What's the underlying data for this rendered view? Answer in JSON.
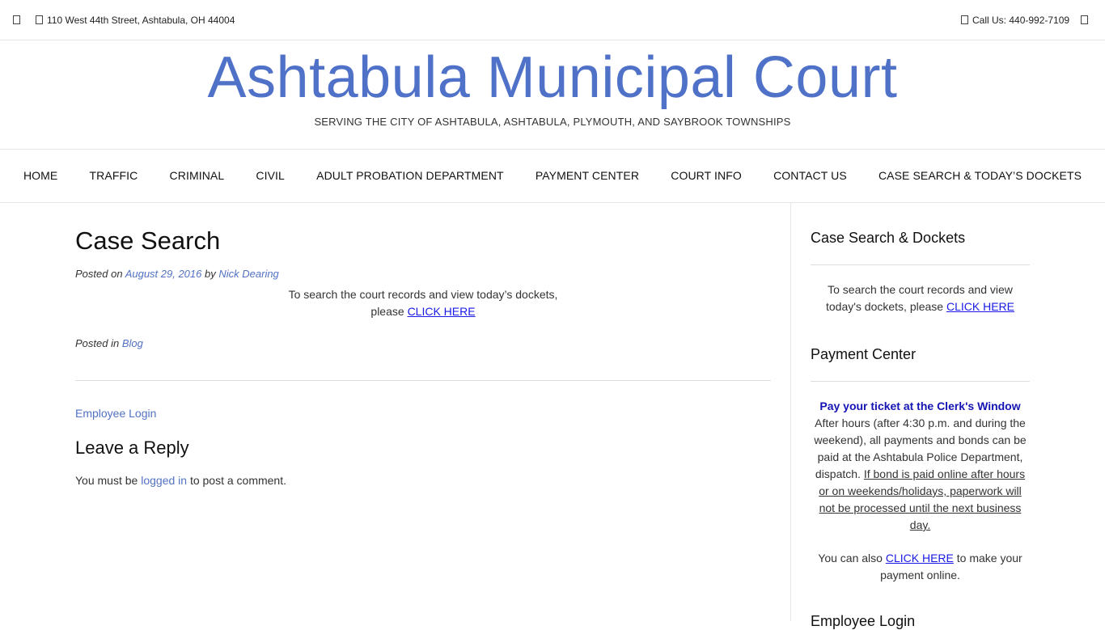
{
  "topbar": {
    "address": "110 West 44th Street, Ashtabula, OH 44004",
    "phone": "Call Us: 440-992-7109"
  },
  "header": {
    "title": "Ashtabula Municipal Court",
    "tagline": "SERVING THE CITY OF ASHTABULA, ASHTABULA, PLYMOUTH, AND SAYBROOK TOWNSHIPS"
  },
  "nav": {
    "items": [
      {
        "label": "HOME"
      },
      {
        "label": "TRAFFIC"
      },
      {
        "label": "CRIMINAL"
      },
      {
        "label": "CIVIL"
      },
      {
        "label": "ADULT PROBATION DEPARTMENT"
      },
      {
        "label": "PAYMENT CENTER"
      },
      {
        "label": "COURT INFO"
      },
      {
        "label": "CONTACT US"
      },
      {
        "label": "CASE SEARCH & TODAY’S DOCKETS"
      }
    ]
  },
  "post": {
    "title": "Case Search",
    "posted_on": "Posted on",
    "date": "August 29, 2016",
    "by": "by",
    "author": "Nick Dearing",
    "body_line1": "To search the court records and view today’s dockets,",
    "body_please": "please",
    "body_link": "CLICK HERE",
    "posted_in": "Posted in",
    "category": "Blog"
  },
  "employee_login": "Employee Login",
  "reply": {
    "title": "Leave a Reply",
    "text_before": "You must be",
    "link": "logged in",
    "text_after": "to post a comment."
  },
  "sidebar": {
    "case_search": {
      "title": "Case Search & Dockets",
      "text": "To search the court records and view today's dockets, please",
      "link": "CLICK HERE"
    },
    "payment": {
      "title": "Payment Center",
      "heading": "Pay your ticket at the Clerk's Window",
      "text": "After hours (after 4:30 p.m. and during the weekend), all payments and bonds can be paid at the Ashtabula Police Department, dispatch.",
      "underlined": "If bond is paid online after hours or on weekends/holidays, paperwork will not be processed until the next business day.",
      "also_before": "You can also",
      "also_link": "CLICK HERE",
      "also_after": "to make your payment online."
    },
    "employee_login_title": "Employee Login"
  },
  "colors": {
    "title_blue": "#4f72c8",
    "link_blue": "#5272c4",
    "click_here": "#1a1ae6",
    "pay_heading": "#1414b4"
  },
  "icons": [
    "social-icon-left",
    "map-marker-icon",
    "phone-icon",
    "social-icon-right"
  ]
}
